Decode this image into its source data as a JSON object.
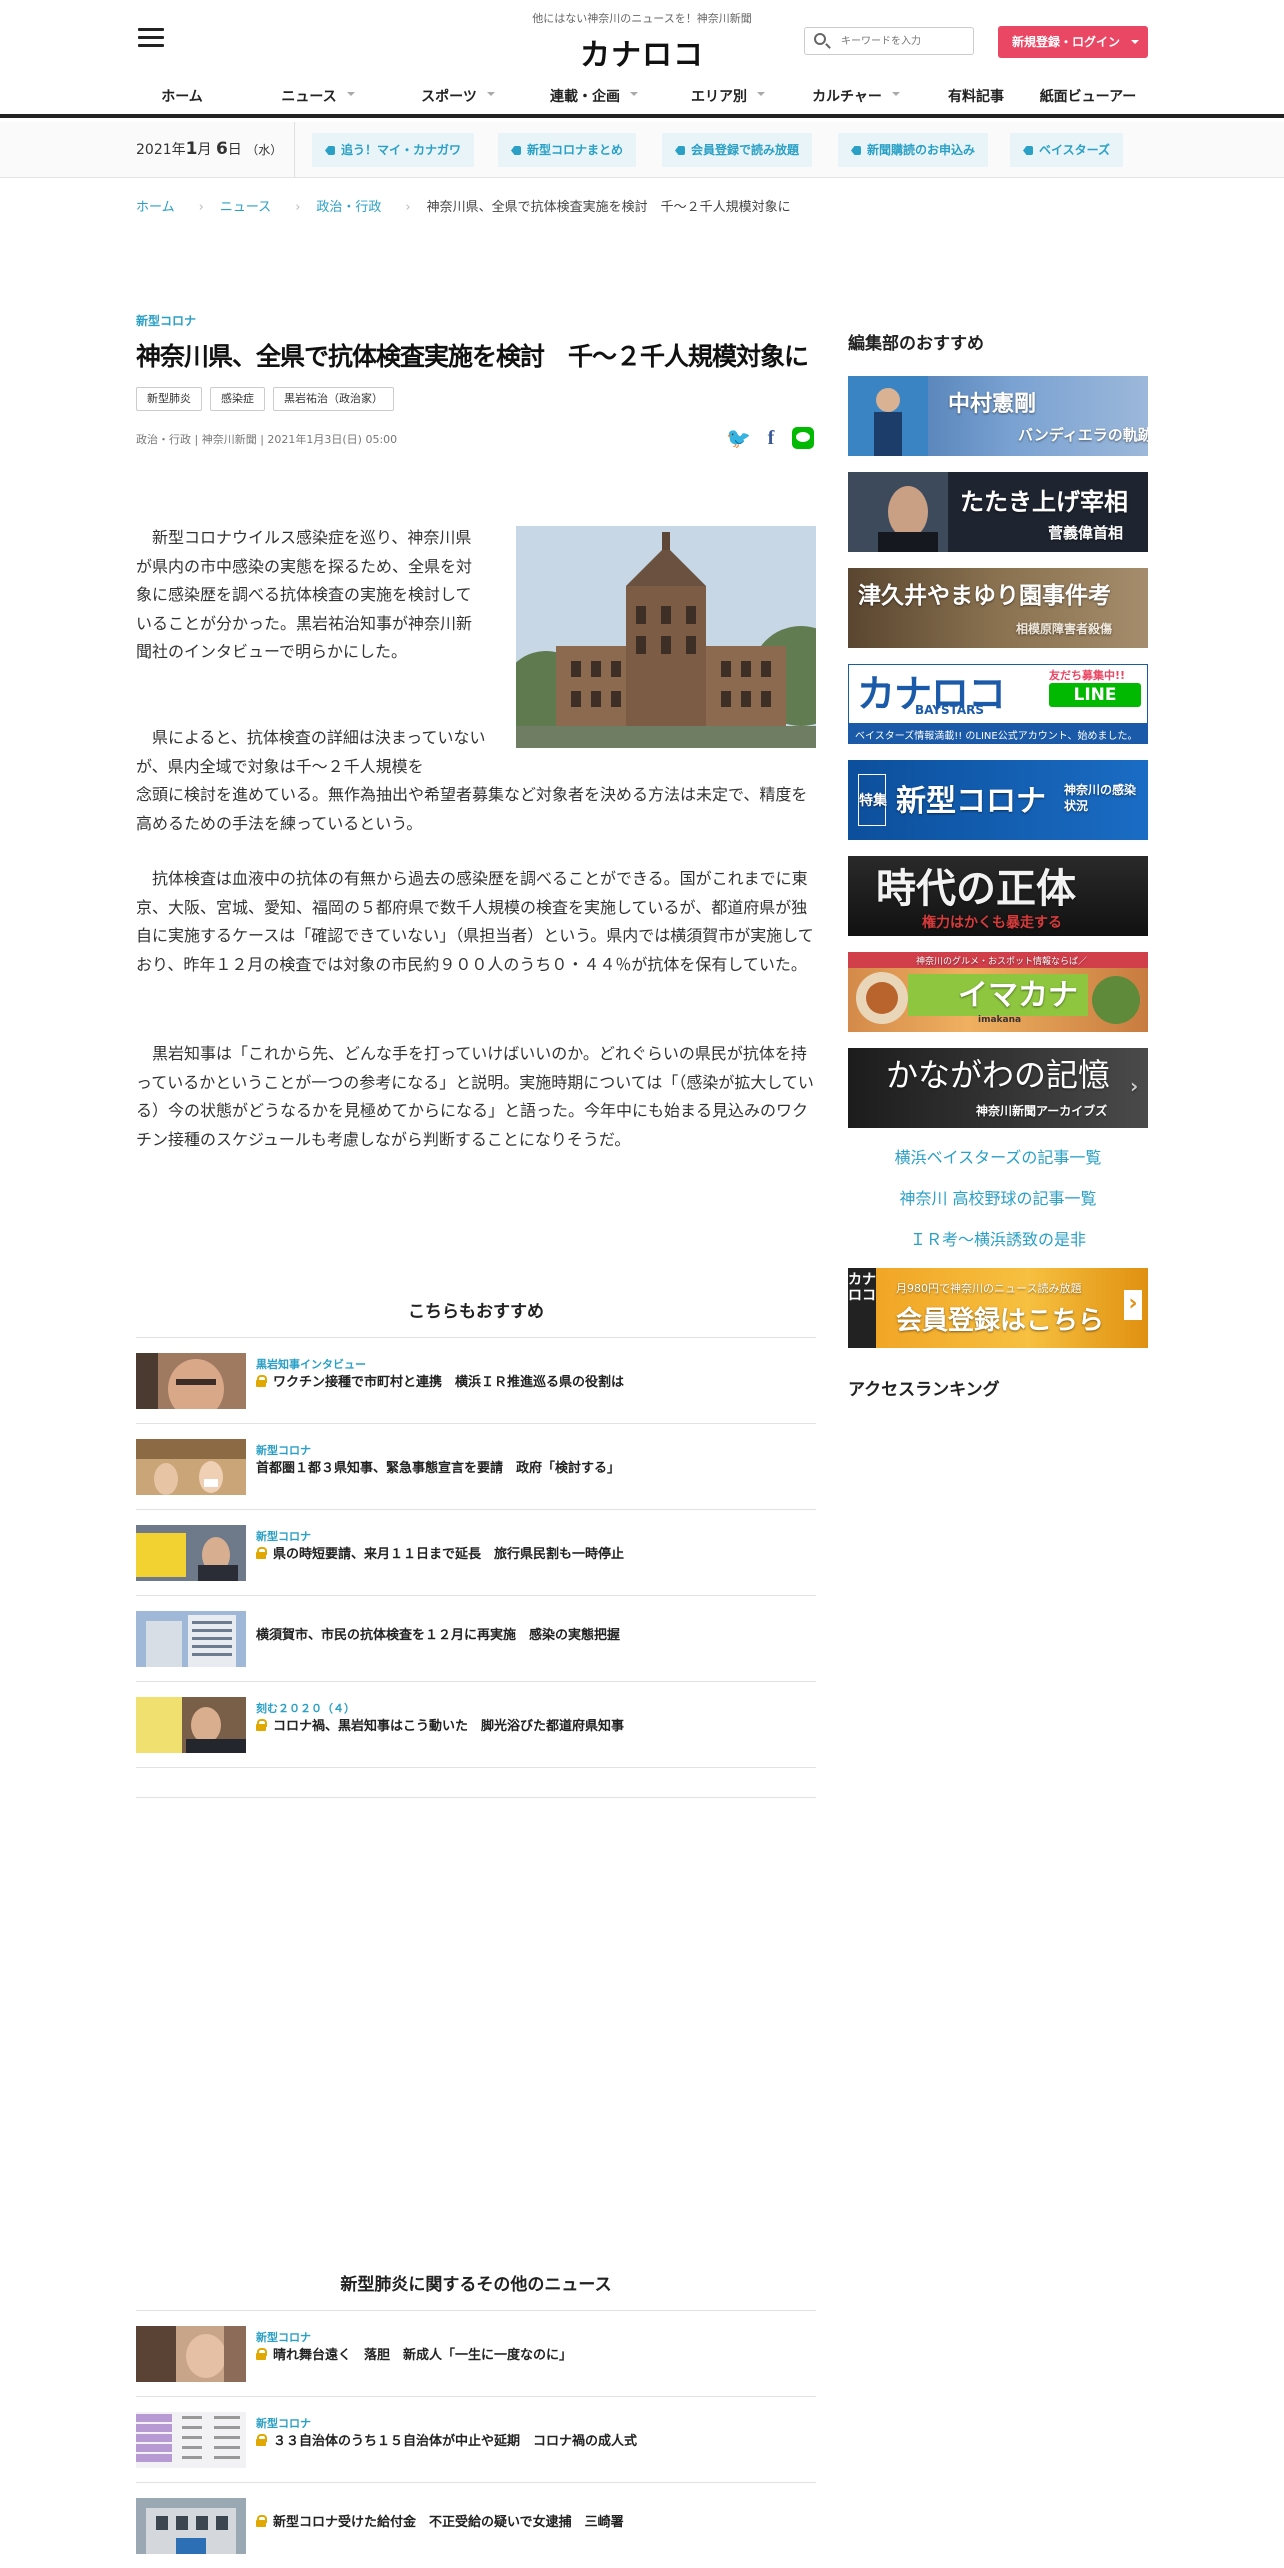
{
  "header": {
    "tagline": "他にはない神奈川のニュースを！神奈川新聞",
    "logo": "カナロコ",
    "search_placeholder": "キーワードを入力",
    "login_label": "新規登録・ログイン"
  },
  "nav": [
    {
      "label": "ホーム",
      "dropdown": false
    },
    {
      "label": "ニュース",
      "dropdown": true
    },
    {
      "label": "スポーツ",
      "dropdown": true
    },
    {
      "label": "連載・企画",
      "dropdown": true
    },
    {
      "label": "エリア別",
      "dropdown": true
    },
    {
      "label": "カルチャー",
      "dropdown": true
    },
    {
      "label": "有料記事",
      "dropdown": false
    },
    {
      "label": "紙面ビューアー",
      "dropdown": false
    }
  ],
  "subbar": {
    "date_year": "2021年",
    "date_month": "1",
    "date_day": "6",
    "date_weekday": "（水）",
    "chips": [
      "追う！マイ・カナガワ",
      "新型コロナまとめ",
      "会員登録で読み放題",
      "新聞購読のお申込み",
      "ベイスターズ"
    ]
  },
  "breadcrumb": {
    "home": "ホーム",
    "news": "ニュース",
    "section": "政治・行政",
    "current": "神奈川県、全県で抗体検査実施を検討　千～２千人規模対象に"
  },
  "article": {
    "category": "新型コロナ",
    "title": "神奈川県、全県で抗体検査実施を検討　千～２千人規模対象に",
    "tags": [
      "新型肺炎",
      "感染症",
      "黒岩祐治（政治家）"
    ],
    "meta": "政治・行政 | 神奈川新聞 | 2021年1月3日(日) 05:00",
    "p1": "　新型コロナウイルス感染症を巡り、神奈川県が県内の市中感染の実態を探るため、全県を対象に感染歴を調べる抗体検査の実施を検討していることが分かった。黒岩祐治知事が神奈川新聞社のインタビューで明らかにした。",
    "p2a": "　県によると、抗体検査の詳細は決まっていないが、県内全域で対象は千～２千人規模を",
    "p2b": "念頭に検討を進めている。無作為抽出や希望者募集など対象者を決める方法は未定で、精度を高めるための手法を練っているという。",
    "p3": "　抗体検査は血液中の抗体の有無から過去の感染歴を調べることができる。国がこれまでに東京、大阪、宮城、愛知、福岡の５都府県で数千人規模の検査を実施しているが、都道府県が独自に実施するケースは「確認できていない」（県担当者）という。県内では横須賀市が実施しており、昨年１２月の検査では対象の市民約９００人のうち０・４４％が抗体を保有していた。",
    "p4": "　黒岩知事は「これから先、どんな手を打っていけばいいのか。どれぐらいの県民が抗体を持っているかということが一つの参考になる」と説明。実施時期については「（感染が拡大している）今の状態がどうなるかを見極めてからになる」と語った。今年中にも始まる見込みのワクチン接種のスケジュールも考慮しながら判断することになりそうだ。"
  },
  "recommend": {
    "heading": "こちらもおすすめ",
    "items": [
      {
        "category": "黒岩知事インタビュー",
        "title": "ワクチン接種で市町村と連携　横浜ＩＲ推進巡る県の役割は",
        "locked": true
      },
      {
        "category": "新型コロナ",
        "title": "首都圏１都３県知事、緊急事態宣言を要請　政府「検討する」",
        "locked": false
      },
      {
        "category": "新型コロナ",
        "title": "県の時短要請、来月１１日まで延長　旅行県民割も一時停止",
        "locked": true
      },
      {
        "category": "",
        "title": "横須賀市、市民の抗体検査を１２月に再実施　感染の実態把握",
        "locked": false
      },
      {
        "category": "刻む２０２０（４）",
        "title": "コロナ禍、黒岩知事はこう動いた　脚光浴びた都道府県知事",
        "locked": true
      }
    ]
  },
  "related": {
    "heading": "新型肺炎に関するその他のニュース",
    "items": [
      {
        "category": "新型コロナ",
        "title": "晴れ舞台遠く　落胆　新成人「一生に一度なのに」",
        "locked": true
      },
      {
        "category": "新型コロナ",
        "title": "３３自治体のうち１５自治体が中止や延期　コロナ禍の成人式",
        "locked": true
      },
      {
        "category": "",
        "title": "新型コロナ受けた給付金　不正受給の疑いで女逮捕　三崎署",
        "locked": true
      }
    ]
  },
  "sidebar": {
    "heading": "編集部のおすすめ",
    "banners": [
      {
        "title": "中村憲剛",
        "subtitle": "バンディエラの軌跡"
      },
      {
        "title": "たたき上げ宰相",
        "subtitle": "菅義偉首相"
      },
      {
        "title": "津久井やまゆり園事件考",
        "subtitle": "相模原障害者殺傷"
      },
      {
        "title": "カナロコ",
        "subtitle": "BAYSTARS",
        "badge": "友だち募集中!!",
        "line": "LINE",
        "note": "ベイスターズ情報満載!! のLINE公式アカウント、始めました。"
      },
      {
        "title": "新型コロナ",
        "subtitle": "神奈川の感染状況",
        "badge": "特集"
      },
      {
        "title": "時代の正体",
        "subtitle": "権力はかくも暴走する"
      },
      {
        "title": "イマカナ",
        "subtitle": "神奈川のグルメ・おスポット情報ならば／",
        "note": "imakana"
      },
      {
        "title": "かながわの記憶",
        "subtitle": "神奈川新聞アーカイブズ"
      }
    ],
    "links": [
      "横浜ベイスターズの記事一覧",
      "神奈川 高校野球の記事一覧",
      "ＩＲ考～横浜誘致の是非"
    ],
    "member_banner": {
      "logo": "カナロコ",
      "line1": "月980円で神奈川のニュース読み放題",
      "line2": "会員登録はこちら"
    },
    "ranking_heading": "アクセスランキング"
  },
  "colors": {
    "accent": "#2aa0c6",
    "login": "#e94763",
    "lock": "#e0a800"
  }
}
